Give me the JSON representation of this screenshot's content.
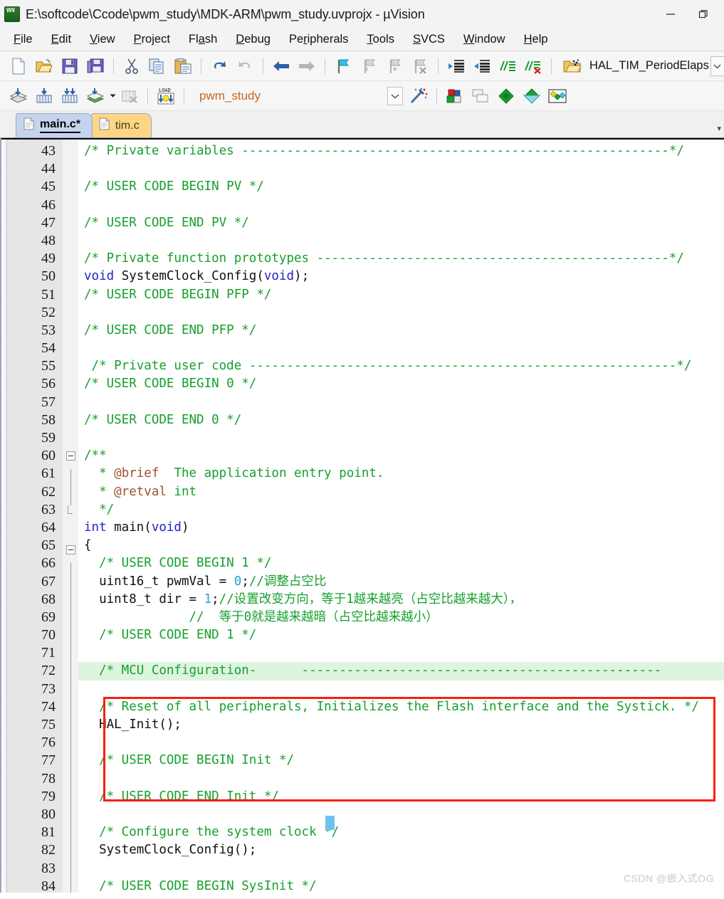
{
  "window": {
    "title": "E:\\softcode\\Ccode\\pwm_study\\MDK-ARM\\pwm_study.uvprojx - µVision",
    "app_icon": "uvision-icon",
    "minimize_label": "Minimize",
    "restore_label": "Restore"
  },
  "menubar": {
    "items": [
      {
        "label": "File",
        "accel": "F"
      },
      {
        "label": "Edit",
        "accel": "E"
      },
      {
        "label": "View",
        "accel": "V"
      },
      {
        "label": "Project",
        "accel": "P"
      },
      {
        "label": "Flash",
        "accel": "a"
      },
      {
        "label": "Debug",
        "accel": "D"
      },
      {
        "label": "Peripherals",
        "accel": "r"
      },
      {
        "label": "Tools",
        "accel": "T"
      },
      {
        "label": "SVCS",
        "accel": "S"
      },
      {
        "label": "Window",
        "accel": "W"
      },
      {
        "label": "Help",
        "accel": "H"
      }
    ]
  },
  "toolbar_main": {
    "buttons": [
      "new-file-icon",
      "open-file-icon",
      "save-icon",
      "save-all-icon",
      "cut-icon",
      "copy-icon",
      "paste-icon",
      "undo-icon",
      "redo-icon",
      "navigate-back-icon",
      "navigate-forward-icon",
      "bookmark-toggle-icon",
      "bookmark-prev-icon",
      "bookmark-next-icon",
      "bookmark-clear-icon",
      "indent-right-icon",
      "indent-left-icon",
      "comment-icon",
      "uncomment-icon",
      "function-browse-icon"
    ],
    "function_value": "HAL_TIM_PeriodElaps",
    "function_dropdown": "chevron-down-icon"
  },
  "toolbar_build": {
    "buttons": [
      "translate-icon",
      "build-icon",
      "rebuild-icon",
      "batch-build-icon",
      "stop-build-icon",
      "load-icon"
    ],
    "project_value": "pwm_study",
    "project_dropdown": "chevron-down-icon",
    "right_buttons": [
      "target-options-icon",
      "manage-windows-icon",
      "configuration-wizard-icon",
      "pack-installer-icon",
      "manage-rte-icon"
    ],
    "magic_wand": "magic-wand-icon"
  },
  "tabs": {
    "items": [
      {
        "label": "main.c*",
        "active": true,
        "icon": "c-file-icon"
      },
      {
        "label": "tim.c",
        "active": false,
        "icon": "c-file-icon"
      }
    ],
    "scroll_icon": "tab-scroll-icon"
  },
  "editor": {
    "first_line": 43,
    "caret_line": 72,
    "highlighted_line": 72,
    "colors": {
      "comment": "#16a02c",
      "keyword": "#2222cc",
      "number": "#2aa0dd",
      "doc_param": "#a0522d",
      "gutter_bg": "#e6e6e6",
      "current_line_bg": "#ddf4de",
      "highlight_box": "#fa1e0e",
      "caret_block": "#6fc2ee"
    },
    "lines": [
      {
        "n": 43,
        "fold": "",
        "tokens": [
          {
            "t": "/* Private variables ---------------------------------------------------------*/",
            "c": "cmt"
          }
        ]
      },
      {
        "n": 44,
        "fold": "",
        "tokens": []
      },
      {
        "n": 45,
        "fold": "",
        "tokens": [
          {
            "t": "/* USER CODE BEGIN PV */",
            "c": "cmt"
          }
        ]
      },
      {
        "n": 46,
        "fold": "",
        "tokens": []
      },
      {
        "n": 47,
        "fold": "",
        "tokens": [
          {
            "t": "/* USER CODE END PV */",
            "c": "cmt"
          }
        ]
      },
      {
        "n": 48,
        "fold": "",
        "tokens": []
      },
      {
        "n": 49,
        "fold": "",
        "tokens": [
          {
            "t": "/* Private function prototypes -----------------------------------------------*/",
            "c": "cmt"
          }
        ]
      },
      {
        "n": 50,
        "fold": "",
        "tokens": [
          {
            "t": "void",
            "c": "kw"
          },
          {
            "t": " SystemClock_Config(",
            "c": "plain"
          },
          {
            "t": "void",
            "c": "kw"
          },
          {
            "t": ");",
            "c": "plain"
          }
        ]
      },
      {
        "n": 51,
        "fold": "",
        "tokens": [
          {
            "t": "/* USER CODE BEGIN PFP */",
            "c": "cmt"
          }
        ]
      },
      {
        "n": 52,
        "fold": "",
        "tokens": []
      },
      {
        "n": 53,
        "fold": "",
        "tokens": [
          {
            "t": "/* USER CODE END PFP */",
            "c": "cmt"
          }
        ]
      },
      {
        "n": 54,
        "fold": "",
        "tokens": []
      },
      {
        "n": 55,
        "fold": "",
        "tokens": [
          {
            "t": " /* Private user code ---------------------------------------------------------*/",
            "c": "cmt"
          }
        ]
      },
      {
        "n": 56,
        "fold": "",
        "tokens": [
          {
            "t": "/* USER CODE BEGIN 0 */",
            "c": "cmt"
          }
        ]
      },
      {
        "n": 57,
        "fold": "",
        "tokens": []
      },
      {
        "n": 58,
        "fold": "",
        "tokens": [
          {
            "t": "/* USER CODE END 0 */",
            "c": "cmt"
          }
        ]
      },
      {
        "n": 59,
        "fold": "",
        "tokens": []
      },
      {
        "n": 60,
        "fold": "box",
        "tokens": [
          {
            "t": "/**",
            "c": "cmt"
          }
        ]
      },
      {
        "n": 61,
        "fold": "line",
        "tokens": [
          {
            "t": "  * ",
            "c": "cmt"
          },
          {
            "t": "@brief",
            "c": "docparam"
          },
          {
            "t": "  The application entry point.",
            "c": "cmt"
          }
        ]
      },
      {
        "n": 62,
        "fold": "line",
        "tokens": [
          {
            "t": "  * ",
            "c": "cmt"
          },
          {
            "t": "@retval",
            "c": "docparam"
          },
          {
            "t": " int",
            "c": "cmt"
          }
        ]
      },
      {
        "n": 63,
        "fold": "end",
        "tokens": [
          {
            "t": "  */",
            "c": "cmt"
          }
        ]
      },
      {
        "n": 64,
        "fold": "",
        "tokens": [
          {
            "t": "int",
            "c": "kw"
          },
          {
            "t": " main(",
            "c": "plain"
          },
          {
            "t": "void",
            "c": "kw"
          },
          {
            "t": ")",
            "c": "plain"
          }
        ]
      },
      {
        "n": 65,
        "fold": "box",
        "tokens": [
          {
            "t": "{",
            "c": "plain"
          }
        ]
      },
      {
        "n": 66,
        "fold": "line",
        "tokens": [
          {
            "t": "  /* USER CODE BEGIN 1 */",
            "c": "cmt"
          }
        ]
      },
      {
        "n": 67,
        "fold": "line",
        "tokens": [
          {
            "t": "  uint16_t pwmVal = ",
            "c": "plain"
          },
          {
            "t": "0",
            "c": "num"
          },
          {
            "t": ";",
            "c": "plain"
          },
          {
            "t": "//调整占空比",
            "c": "cmt"
          }
        ]
      },
      {
        "n": 68,
        "fold": "line",
        "tokens": [
          {
            "t": "  uint8_t dir = ",
            "c": "plain"
          },
          {
            "t": "1",
            "c": "num"
          },
          {
            "t": ";",
            "c": "plain"
          },
          {
            "t": "//设置改变方向，等于1越来越亮（占空比越来越大），",
            "c": "cmt"
          }
        ]
      },
      {
        "n": 69,
        "fold": "line",
        "tokens": [
          {
            "t": "              //  等于0就是越来越暗（占空比越来越小）",
            "c": "cmt"
          }
        ]
      },
      {
        "n": 70,
        "fold": "line",
        "tokens": [
          {
            "t": "  /* USER CODE END 1 */",
            "c": "cmt"
          }
        ]
      },
      {
        "n": 71,
        "fold": "line",
        "tokens": []
      },
      {
        "n": 72,
        "fold": "line",
        "hl": true,
        "tokens": [
          {
            "t": "  /* MCU Configuration- ",
            "c": "cmt"
          },
          {
            "t": "     ------------------------------------------------",
            "c": "cmt"
          }
        ]
      },
      {
        "n": 73,
        "fold": "line",
        "tokens": []
      },
      {
        "n": 74,
        "fold": "line",
        "tokens": [
          {
            "t": "  /* Reset of all peripherals, Initializes the Flash interface and the Systick. */",
            "c": "cmt"
          }
        ]
      },
      {
        "n": 75,
        "fold": "line",
        "tokens": [
          {
            "t": "  HAL_Init();",
            "c": "plain"
          }
        ]
      },
      {
        "n": 76,
        "fold": "line",
        "tokens": []
      },
      {
        "n": 77,
        "fold": "line",
        "tokens": [
          {
            "t": "  /* USER CODE BEGIN Init */",
            "c": "cmt"
          }
        ]
      },
      {
        "n": 78,
        "fold": "line",
        "tokens": []
      },
      {
        "n": 79,
        "fold": "line",
        "tokens": [
          {
            "t": "  /* USER CODE END Init */",
            "c": "cmt"
          }
        ]
      },
      {
        "n": 80,
        "fold": "line",
        "tokens": []
      },
      {
        "n": 81,
        "fold": "line",
        "tokens": [
          {
            "t": "  /* Configure the system clock */",
            "c": "cmt"
          }
        ]
      },
      {
        "n": 82,
        "fold": "line",
        "tokens": [
          {
            "t": "  SystemClock_Config();",
            "c": "plain"
          }
        ]
      },
      {
        "n": 83,
        "fold": "line",
        "tokens": []
      },
      {
        "n": 84,
        "fold": "line",
        "tokens": [
          {
            "t": "  /* USER CODE BEGIN SysInit */",
            "c": "cmt"
          }
        ]
      }
    ]
  },
  "watermark": {
    "text": "CSDN @嵌入式OG"
  }
}
